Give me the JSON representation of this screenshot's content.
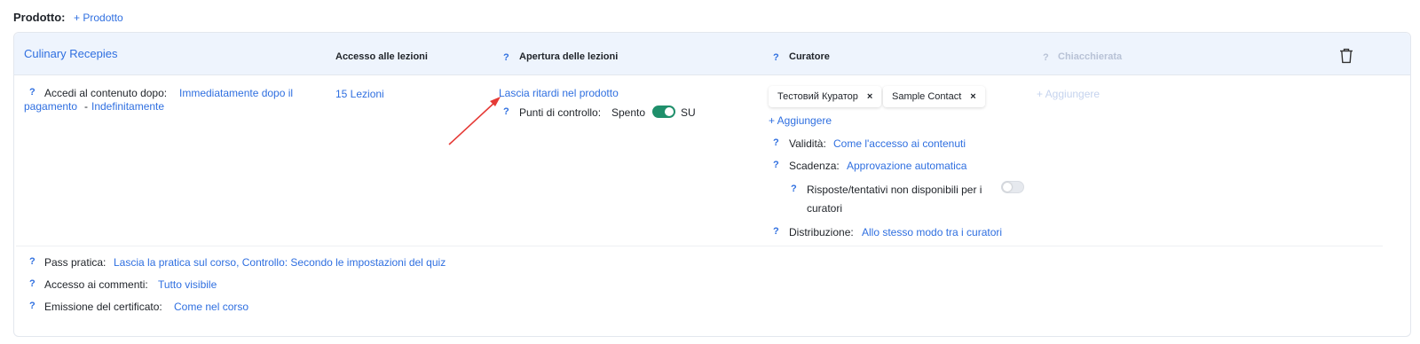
{
  "header": {
    "label": "Prodotto:",
    "add_product": "+ Prodotto"
  },
  "card": {
    "product_name": "Culinary Recepies",
    "columns": {
      "access": "Accesso alle lezioni",
      "opening": "Apertura delle lezioni",
      "curator": "Curatore",
      "chat": "Chiacchierata"
    },
    "question_mark": "?",
    "access_after": {
      "label": "Accedi al contenuto dopo:",
      "value_line1": "Immediatamente dopo il",
      "value_line2": "pagamento",
      "separator": "-",
      "duration": "Indefinitamente"
    },
    "lessons_count": "15 Lezioni",
    "opening": {
      "delays_link": "Lascia ritardi nel prodotto",
      "checkpoints_label": "Punti di controllo:",
      "checkpoints_off": "Spento",
      "checkpoints_on": "SU",
      "checkpoints_enabled": true
    },
    "curators": {
      "chips": [
        "Тестовий Куратор",
        "Sample Contact"
      ],
      "remove_glyph": "×",
      "add": "+ Aggiungere",
      "validity_label": "Validità:",
      "validity_value": "Come l'accesso ai contenuti",
      "deadline_label": "Scadenza:",
      "deadline_value": "Approvazione automatica",
      "answers_label_line1": "Risposte/tentativi non disponibili per i",
      "answers_label_line2": "curatori",
      "answers_enabled": false,
      "distribution_label": "Distribuzione:",
      "distribution_value": "Allo stesso modo tra i curatori"
    },
    "chat_add": "+ Aggiungere",
    "footer": {
      "practice_label": "Pass pratica:",
      "practice_value": "Lascia la pratica sul corso, Controllo: Secondo le impostazioni del quiz",
      "comments_label": "Accesso ai commenti:",
      "comments_value": "Tutto visibile",
      "certificate_label": "Emissione del certificato:",
      "certificate_value": "Come nel corso"
    }
  },
  "icons": {
    "delete": "trash-icon",
    "annotation": "red-arrow-annotation"
  },
  "colors": {
    "link": "#2f6fe0",
    "header_bg": "#eef4fd",
    "toggle_on": "#1f8f6b",
    "arrow": "#e53935"
  }
}
